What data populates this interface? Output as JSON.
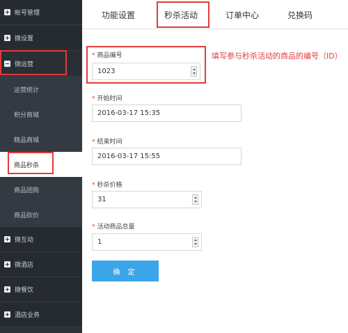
{
  "sidebar": {
    "items": [
      {
        "label": "帐号管理",
        "type": "top",
        "icon": "square-plus-icon"
      },
      {
        "label": "微设置",
        "type": "top",
        "icon": "square-plus-icon"
      },
      {
        "label": "微运营",
        "type": "top",
        "icon": "square-minus-icon"
      },
      {
        "label": "运营统计",
        "type": "sub"
      },
      {
        "label": "积分商城",
        "type": "sub"
      },
      {
        "label": "精品商城",
        "type": "sub"
      },
      {
        "label": "商品秒杀",
        "type": "sub",
        "active": true
      },
      {
        "label": "商品团购",
        "type": "sub"
      },
      {
        "label": "商品砍价",
        "type": "sub"
      },
      {
        "label": "微互动",
        "type": "top",
        "icon": "square-plus-icon"
      },
      {
        "label": "微酒店",
        "type": "top",
        "icon": "square-plus-icon"
      },
      {
        "label": "微餐饮",
        "type": "top",
        "icon": "square-plus-icon"
      },
      {
        "label": "酒店业务",
        "type": "top",
        "icon": "square-plus-icon"
      }
    ]
  },
  "tabs": [
    {
      "label": "功能设置"
    },
    {
      "label": "秒杀活动",
      "active": true
    },
    {
      "label": "订单中心"
    },
    {
      "label": "兑换码"
    }
  ],
  "form": {
    "product_id": {
      "label": "商品编号",
      "value": "1023"
    },
    "start_time": {
      "label": "开始时间",
      "value": "2016-03-17 15:35"
    },
    "end_time": {
      "label": "结束时间",
      "value": "2016-03-17 15:55"
    },
    "price": {
      "label": "秒杀价格",
      "value": "31"
    },
    "quantity": {
      "label": "活动商品总量",
      "value": "1"
    },
    "required_mark": "*",
    "submit_label": "确 定"
  },
  "annotation": {
    "note": "填写参与秒杀活动的商品的编号（ID）"
  },
  "colors": {
    "sidebar_bg": "#2d3239",
    "accent_button": "#3aa5e8",
    "annotation_red": "#e33a3a",
    "required_star": "#e23a3a"
  }
}
